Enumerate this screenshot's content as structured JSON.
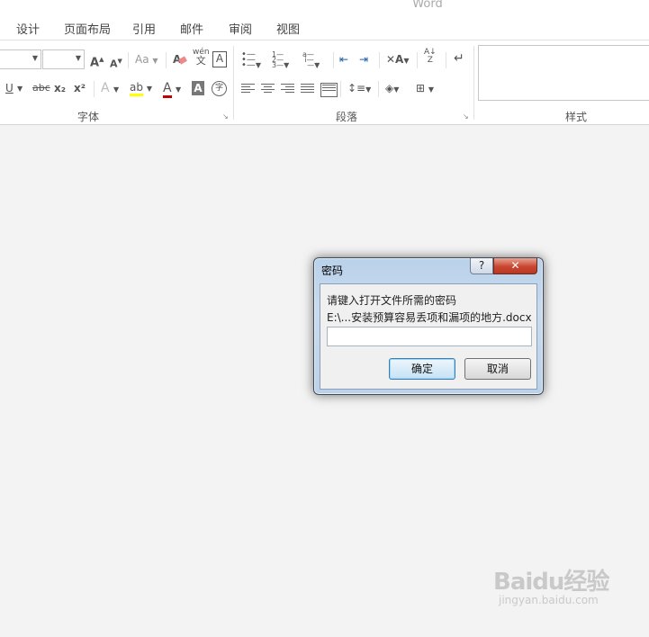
{
  "app_title": "Word",
  "tabs": [
    "设计",
    "页面布局",
    "引用",
    "邮件",
    "审阅",
    "视图"
  ],
  "ribbon": {
    "groups": {
      "font": "字体",
      "paragraph": "段落",
      "styles": "样式"
    },
    "font": {
      "grow_label": "A",
      "shrink_label": "A",
      "case_label": "Aa",
      "phonetic_top": "wén",
      "phonetic_bottom": "文",
      "border_char": "A",
      "underline": "U",
      "strike": "abc",
      "subscript": "x₂",
      "superscript": "x²",
      "effect": "A",
      "highlight": "ab",
      "color": "A",
      "shading": "A",
      "enclose": "字"
    }
  },
  "dialog": {
    "title": "密码",
    "help": "?",
    "close": "✕",
    "prompt": "请键入打开文件所需的密码",
    "path": "E:\\...安装预算容易丢项和漏项的地方.docx",
    "password_value": "",
    "ok": "确定",
    "cancel": "取消"
  },
  "watermark": {
    "logo": "Baidu经验",
    "sub": "jingyan.baidu.com"
  },
  "colors": {
    "highlight": "#ffff00",
    "font_color": "#c00000",
    "dialog_frame": "#c9dbee",
    "close_button": "#c9462f"
  }
}
